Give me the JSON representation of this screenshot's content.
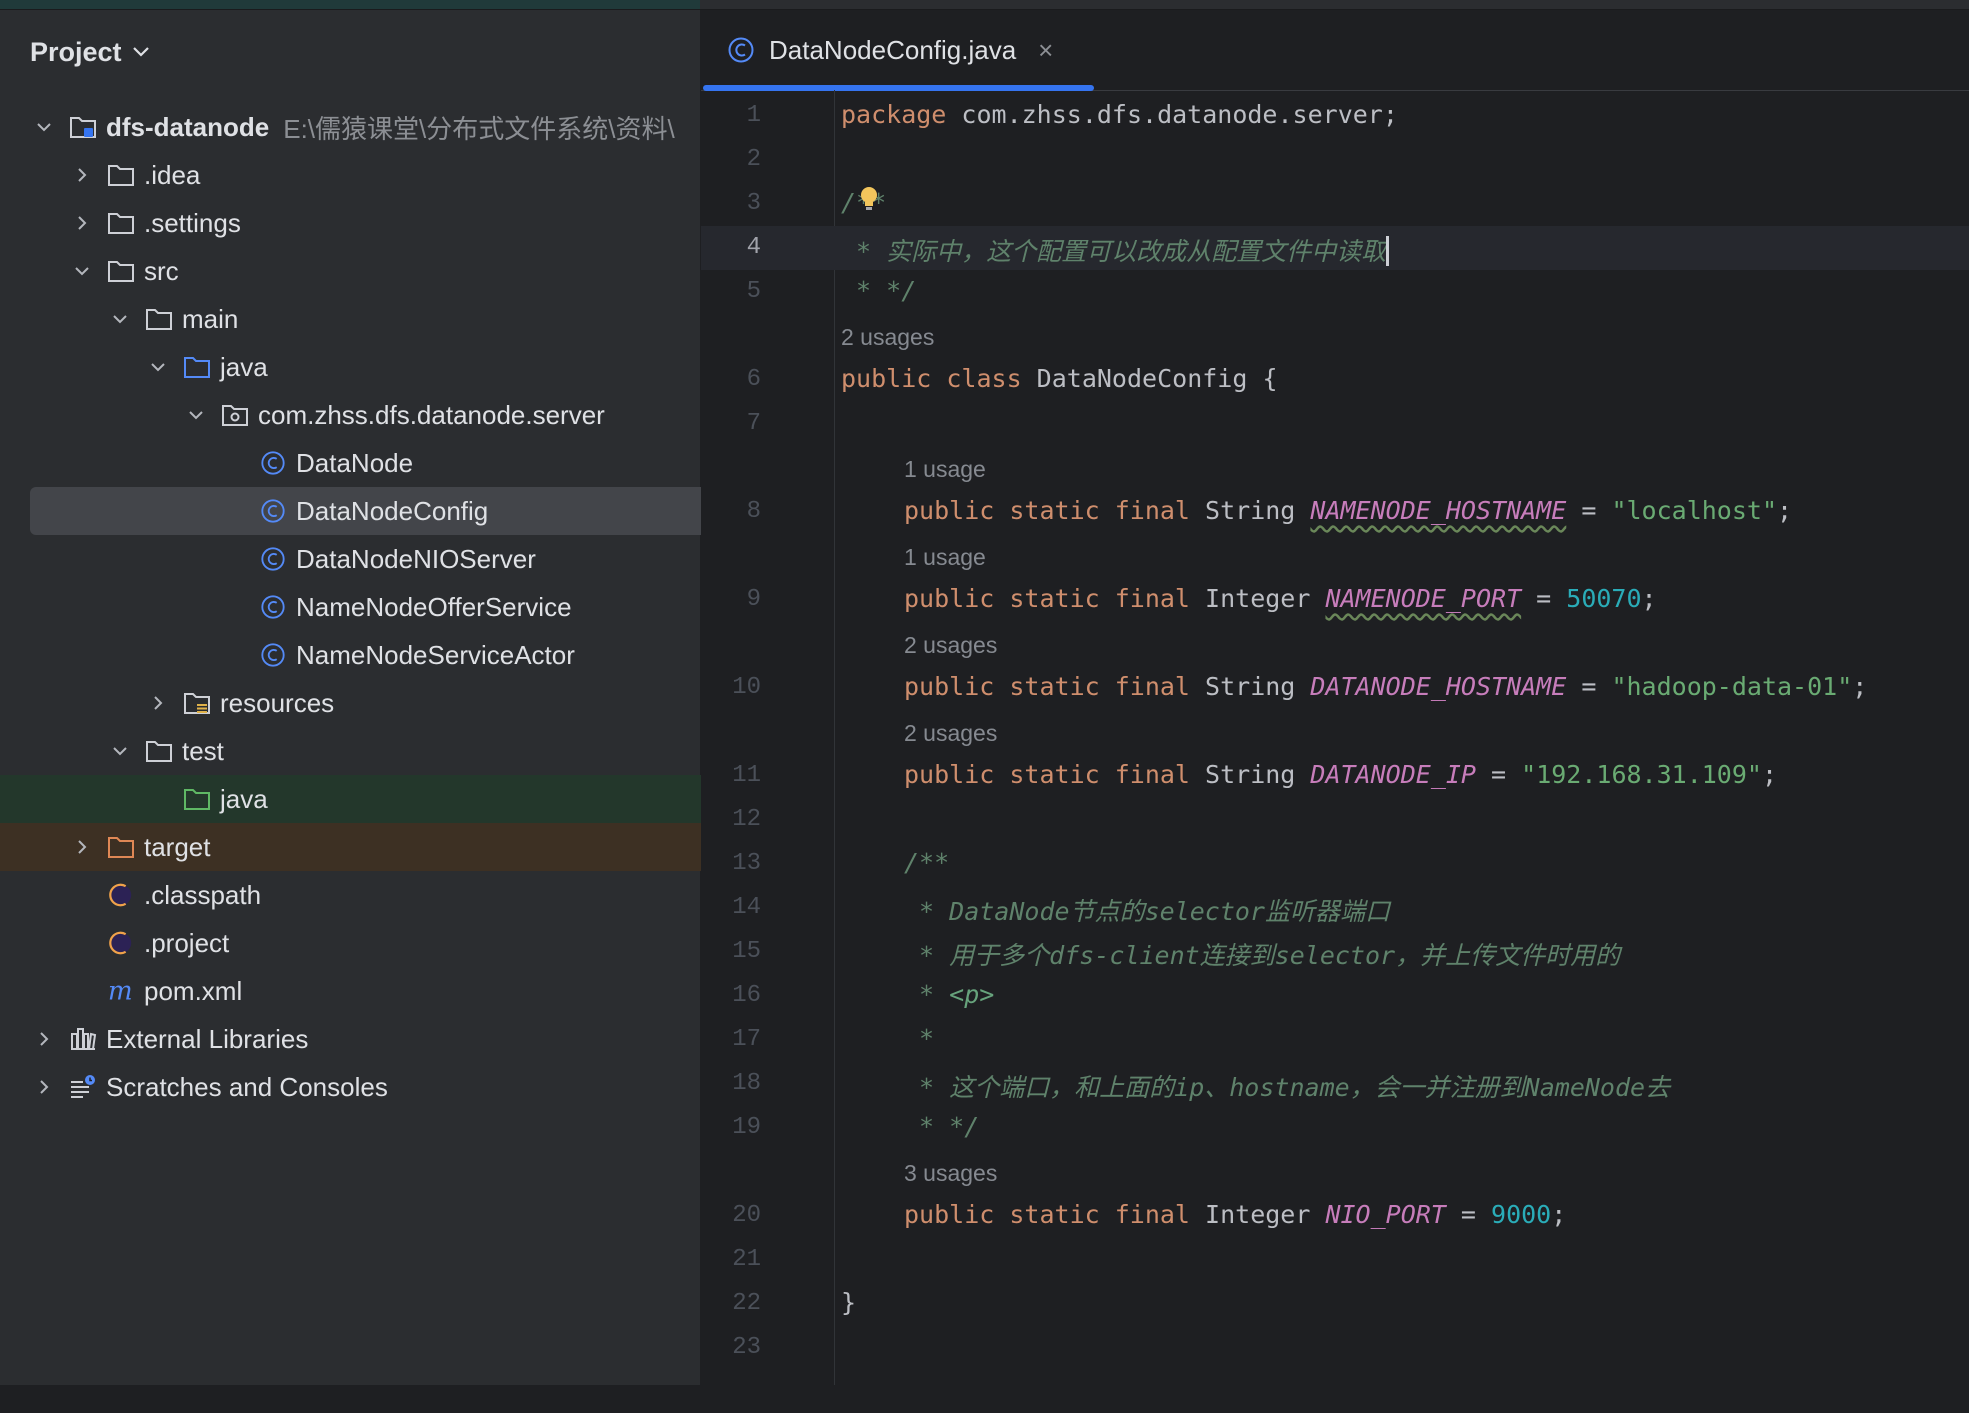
{
  "sidebar": {
    "header": "Project",
    "tree": [
      {
        "label": "dfs-datanode",
        "path": "E:\\儒猿课堂\\分布式文件系统\\资料\\"
      },
      {
        "label": ".idea"
      },
      {
        "label": ".settings"
      },
      {
        "label": "src"
      },
      {
        "label": "main"
      },
      {
        "label": "java"
      },
      {
        "label": "com.zhss.dfs.datanode.server"
      },
      {
        "label": "DataNode"
      },
      {
        "label": "DataNodeConfig"
      },
      {
        "label": "DataNodeNIOServer"
      },
      {
        "label": "NameNodeOfferService"
      },
      {
        "label": "NameNodeServiceActor"
      },
      {
        "label": "resources"
      },
      {
        "label": "test"
      },
      {
        "label": "java"
      },
      {
        "label": "target"
      },
      {
        "label": ".classpath"
      },
      {
        "label": ".project"
      },
      {
        "label": "pom.xml"
      },
      {
        "label": "External Libraries"
      },
      {
        "label": "Scratches and Consoles"
      }
    ]
  },
  "editor": {
    "tab_title": "DataNodeConfig.java",
    "close_glyph": "×",
    "line_numbers": [
      "1",
      "2",
      "3",
      "4",
      "5",
      "6",
      "7",
      "8",
      "9",
      "10",
      "11",
      "12",
      "13",
      "14",
      "15",
      "16",
      "17",
      "18",
      "19",
      "20",
      "21",
      "22",
      "23"
    ],
    "usages": {
      "u6": "2 usages",
      "u8": "1 usage",
      "u9": "1 usage",
      "u10": "2 usages",
      "u11": "2 usages",
      "u20": "3 usages"
    },
    "code": {
      "l1_kw": "package",
      "l1_rest": " com.zhss.dfs.datanode.server;",
      "l3": "/**",
      "l4": " * 实际中，这个配置可以改成从配置文件中读取",
      "l5": " * */",
      "l6_kw": "public class",
      "l6_rest": " DataNodeConfig {",
      "mod": "public static final",
      "t_string": " String ",
      "t_integer": " Integer ",
      "eq": " = ",
      "semi": ";",
      "l8_name": "NAMENODE_HOSTNAME",
      "l8_val": "\"localhost\"",
      "l9_name": "NAMENODE_PORT",
      "l9_val": "50070",
      "l10_name": "DATANODE_HOSTNAME",
      "l10_val": "\"hadoop-data-01\"",
      "l11_name": "DATANODE_IP",
      "l11_val": "\"192.168.31.109\"",
      "l13": "/**",
      "l14": " * DataNode节点的selector监听器端口",
      "l15": " * 用于多个dfs-client连接到selector，并上传文件时用的",
      "l16_star": " * ",
      "l16_tag": "<p>",
      "l17": " *",
      "l18": " * 这个端口，和上面的ip、hostname，会一并注册到NameNode去",
      "l19": " * */",
      "l20_name": "NIO_PORT",
      "l20_val": "9000",
      "l22": "}"
    }
  }
}
